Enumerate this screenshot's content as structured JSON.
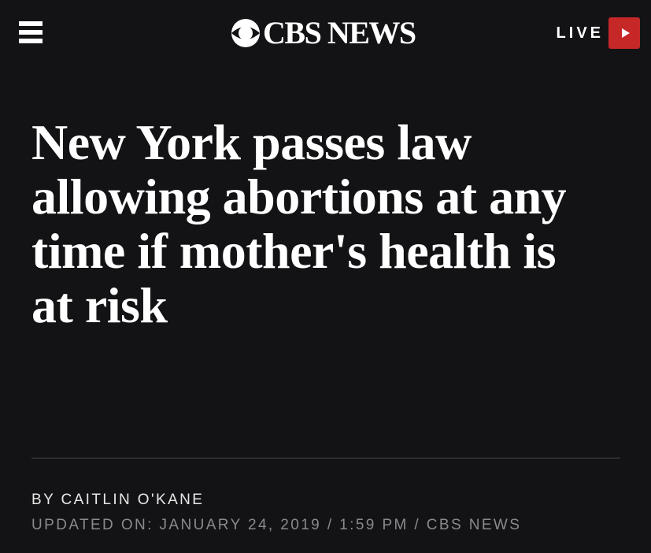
{
  "header": {
    "menu_icon": "hamburger-menu-icon",
    "logo_text": "CBS NEWS",
    "logo_icon": "cbs-eye-icon",
    "live_label": "LIVE",
    "live_icon": "play-icon",
    "live_color": "#c62828",
    "background": "#131315"
  },
  "article": {
    "headline": "New York passes law allowing abortions at any time if mother's health is at risk",
    "byline": "BY CAITLIN O'KANE",
    "updated": "UPDATED ON: JANUARY 24, 2019 / 1:59 PM / CBS NEWS"
  }
}
